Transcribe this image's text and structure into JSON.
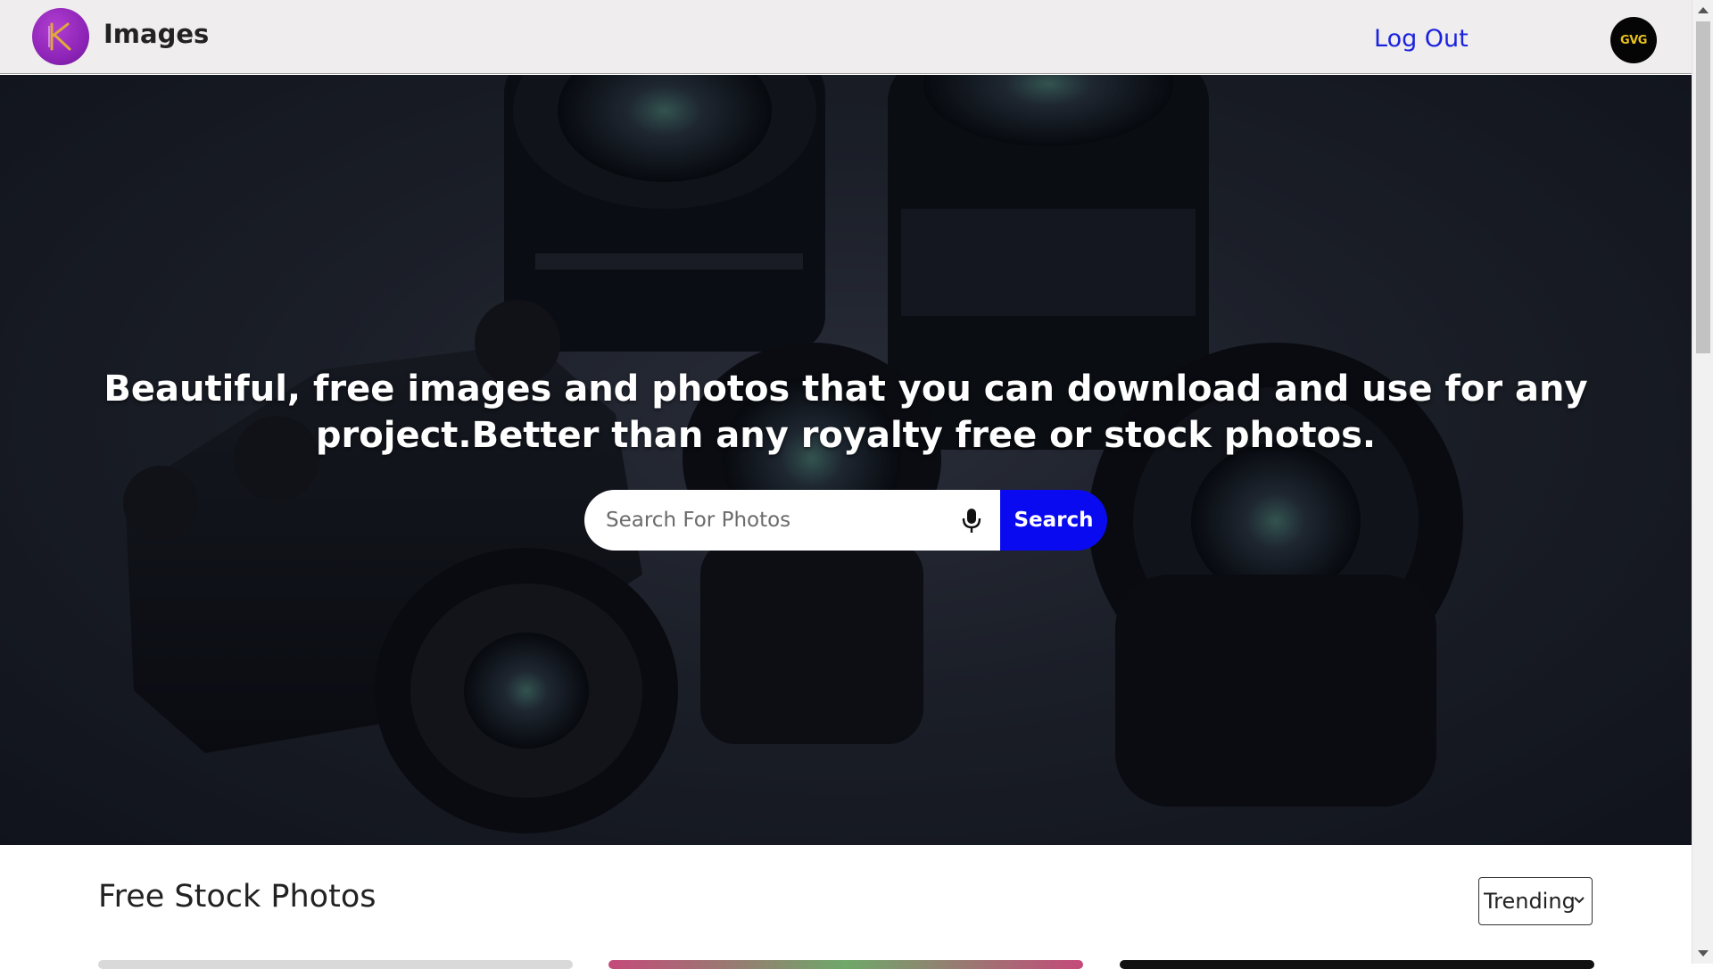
{
  "header": {
    "brand": "Images",
    "logout_label": "Log Out",
    "avatar_text": "GVG",
    "logo_letter": "K",
    "logo_color": "#8e24b8"
  },
  "hero": {
    "headline": "Beautiful, free images and photos that you can download and use for any project.Better than any royalty free or stock photos.",
    "search": {
      "placeholder": "Search For Photos",
      "value": "",
      "button_label": "Search",
      "button_color": "#0a0af0",
      "mic_icon": "microphone-icon"
    }
  },
  "main": {
    "section_title": "Free Stock Photos",
    "sort": {
      "selected": "Trending",
      "chevron_icon": "chevron-down-icon"
    }
  },
  "colors": {
    "link": "#1a22e0",
    "header_bg": "#efeded",
    "avatar_text": "#e7c11c"
  }
}
